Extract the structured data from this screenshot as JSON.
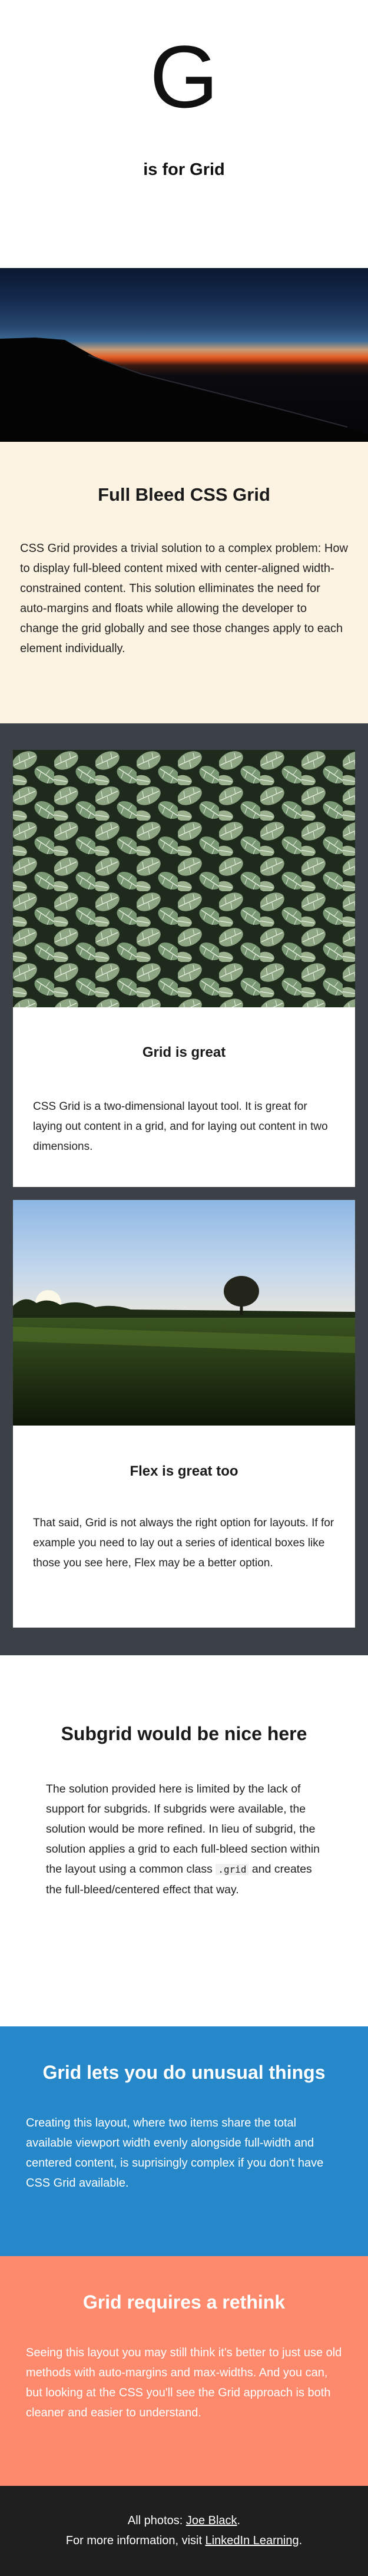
{
  "hero": {
    "letter": "G",
    "subtitle": "is for Grid"
  },
  "fullbleed": {
    "title": "Full Bleed CSS Grid",
    "body": "CSS Grid provides a trivial solution to a complex problem: How to display full-bleed content mixed with center-aligned width-constrained content. This solution elliminates the need for auto-margins and floats while allowing the developer to change the grid globally and see those changes apply to each element individually."
  },
  "cards": [
    {
      "image": "leaves-photo",
      "title": "Grid is great",
      "body": "CSS Grid is a two-dimensional layout tool. It is great for laying out content in a grid, and for laying out content in two dimensions."
    },
    {
      "image": "field-tree-photo",
      "title": "Flex is great too",
      "body": "That said, Grid is not always the right option for layouts. If for example you need to lay out a series of identical boxes like those you see here, Flex may be a better option."
    }
  ],
  "subgrid": {
    "title": "Subgrid would be nice here",
    "body_before": "The solution provided here is limited by the lack of support for subgrids. If subgrids were available, the solution would be more refined. In lieu of subgrid, the solution applies a grid to each full-bleed section within the layout using a common class ",
    "code": ".grid",
    "body_after": " and creates the full-bleed/centered effect that way."
  },
  "unusual": {
    "title": "Grid lets you do unusual things",
    "body": "Creating this layout, where two items share the total available viewport width evenly alongside full-width and centered content, is suprisingly complex if you don't have CSS Grid available."
  },
  "rethink": {
    "title": "Grid requires a rethink",
    "body": "Seeing this layout you may still think it's better to just use old methods with auto-margins and max-widths. And you can, but looking at the CSS you'll see the Grid approach is both cleaner and easier to understand."
  },
  "footer": {
    "photos_prefix": "All photos: ",
    "photos_link": "Joe Black",
    "photos_suffix": ".",
    "info_prefix": "For more information, visit ",
    "info_link": "LinkedIn Learning",
    "info_suffix": "."
  },
  "colors": {
    "cream": "#fdf3e2",
    "dark": "#3c4148",
    "blue": "#2687c9",
    "salmon": "#fd8a6c",
    "footer": "#1f1f1f"
  }
}
